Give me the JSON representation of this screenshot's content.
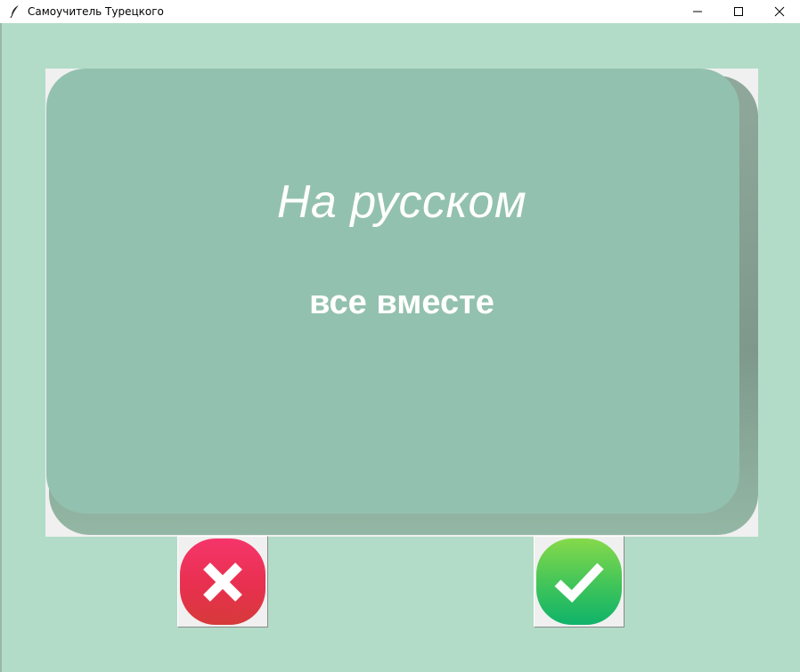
{
  "window": {
    "title": "Самоучитель Турецкого",
    "app_icon": "feather-icon",
    "controls": [
      "minimize-icon",
      "maximize-icon",
      "close-icon"
    ]
  },
  "card": {
    "title": "На русском",
    "word": "все вместе"
  },
  "buttons": {
    "wrong_icon": "x-icon",
    "right_icon": "checkmark-icon"
  },
  "colors": {
    "background": "#b2dcc7",
    "card": "#93c1af",
    "wrong": "#e8304f",
    "right": "#3fc45a",
    "text": "#ffffff"
  }
}
